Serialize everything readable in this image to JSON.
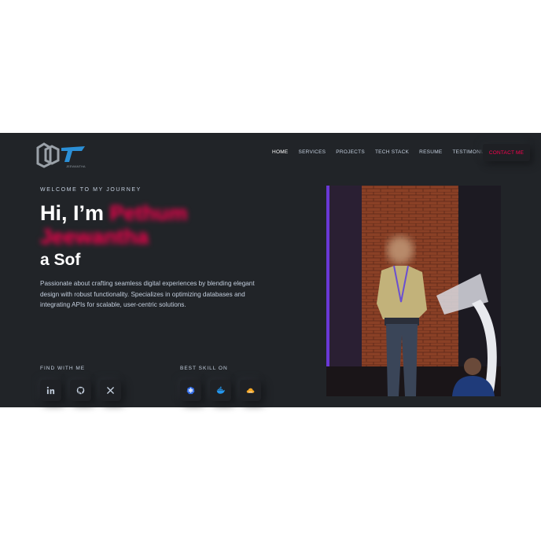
{
  "logo": {
    "alt": "PJ logo",
    "caption": "JEEWANTHA"
  },
  "nav": {
    "items": [
      "HOME",
      "SERVICES",
      "PROJECTS",
      "TECH STACK",
      "RESUME",
      "TESTIMONIALS"
    ],
    "active": "HOME",
    "contact_label": "CONTACT ME"
  },
  "hero": {
    "welcome": "WELCOME TO MY JOURNEY",
    "greeting": "Hi, I’m ",
    "name": "Pethum Jeewantha",
    "role": "a Sof",
    "description": "Passionate about crafting seamless digital experiences by blending elegant design with robust functionality. Specializes in optimizing databases and integrating APIs for scalable, user-centric solutions."
  },
  "social": {
    "label": "FIND WITH ME",
    "icons": [
      "linkedin-icon",
      "github-icon",
      "x-icon"
    ]
  },
  "skills": {
    "label": "BEST SKILL ON",
    "icons": [
      "kubernetes-icon",
      "docker-icon",
      "cloud-icon"
    ]
  },
  "colors": {
    "background": "#212428",
    "accent": "#ff014f",
    "text": "#c4cfde",
    "white": "#ffffff"
  }
}
